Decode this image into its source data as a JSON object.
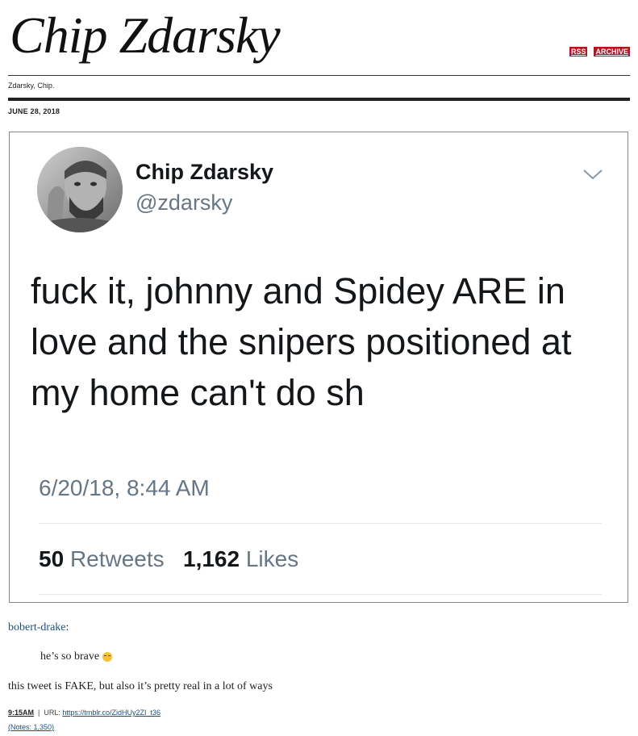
{
  "site": {
    "title": "Chip Zdarsky",
    "links": [
      {
        "label": "RSS"
      },
      {
        "label": "ARCHIVE"
      }
    ],
    "subtitle": "Zdarsky, Chip."
  },
  "post": {
    "date": "JUNE 28, 2018",
    "tweet": {
      "display_name": "Chip Zdarsky",
      "handle": "@zdarsky",
      "text": "fuck it, johnny and Spidey ARE in love and the snipers positioned at my home can't do sh",
      "timestamp": "6/20/18, 8:44 AM",
      "retweets_count": "50",
      "retweets_label": "Retweets",
      "likes_count": "1,162",
      "likes_label": "Likes",
      "avatar_icon": "user-photo-icon",
      "menu_icon": "chevron-down-icon"
    },
    "reblog": {
      "user": "bobert-drake",
      "colon": ":",
      "quote": "he’s so brave",
      "emoji_icon": "unamused-face-icon"
    },
    "comment": "this tweet is FAKE, but also it’s pretty real in a lot of ways",
    "meta": {
      "time": "9:15AM",
      "separator": "|",
      "url_label": "URL:",
      "url": "https://tmblr.co/ZidHUy2ZI_t36",
      "notes": "(Notes: 1,350)"
    }
  },
  "colors": {
    "link_bg": "#b3161b",
    "link_text": "#1a4f8a",
    "tweet_gray": "#657786",
    "tweet_black": "#14171a"
  }
}
